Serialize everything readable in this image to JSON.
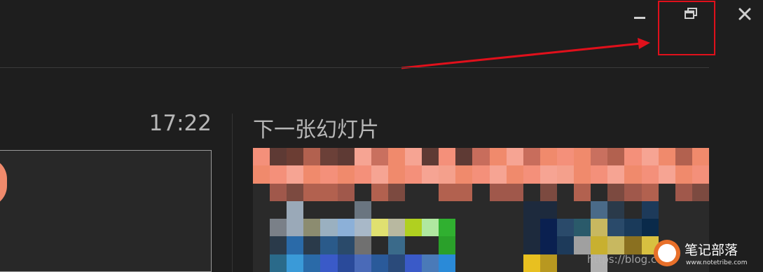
{
  "window_controls": {
    "minimize_icon": "minimize-icon",
    "restore_icon": "restore-icon",
    "close_icon": "close-icon"
  },
  "annotation": {
    "color": "#e0101b"
  },
  "presenter": {
    "timer": "17:22",
    "next_slide_title": "下一张幻灯片"
  },
  "watermark": {
    "url_text": "https://blog.c",
    "logo_text": "笔记部落",
    "logo_subtext": "www.notetribe.com"
  },
  "colors": {
    "background": "#1e1e1e",
    "text": "#b7b7b7",
    "accent": "#f08a6c",
    "highlight": "#e0101b"
  }
}
